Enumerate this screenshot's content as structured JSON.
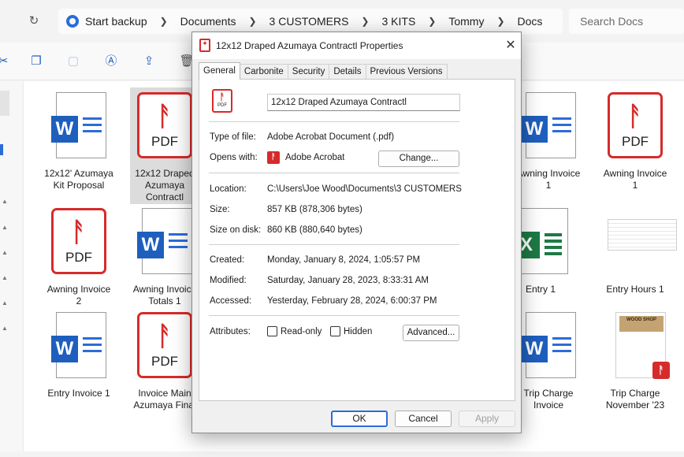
{
  "explorer": {
    "breadcrumb": [
      "Start backup",
      "Documents",
      "3 CUSTOMERS",
      "3 KITS",
      "Tommy",
      "Docs"
    ],
    "search_placeholder": "Search Docs"
  },
  "files": [
    {
      "name": "12x12' Azumaya Kit Proposal",
      "type": "word-icon"
    },
    {
      "name": "12x12 Draped Azumaya Contractl",
      "type": "pdf-icon"
    },
    {
      "name": "Awning Invoice 1",
      "type": "word-icon"
    },
    {
      "name": "Awning Invoice 1",
      "type": "pdf-icon"
    },
    {
      "name": "Awning Invoice 2",
      "type": "pdf-icon"
    },
    {
      "name": "Awning Invoice Totals 1",
      "type": "word-icon"
    },
    {
      "name": "Entry 1",
      "type": "excel-icon"
    },
    {
      "name": "Entry Hours 1",
      "type": "spreadsheet-thumbnail"
    },
    {
      "name": "Entry Invoice 1",
      "type": "word-icon"
    },
    {
      "name": "Invoice Main Azumaya Final",
      "type": "pdf-icon"
    },
    {
      "name": "Trip Charge Invoice",
      "type": "word-icon"
    },
    {
      "name": "Trip Charge November '23",
      "type": "pdf-thumbnail"
    }
  ],
  "icons": {
    "pdf_label": "PDF",
    "word_letter": "W",
    "excel_letter": "X",
    "thumb_header": "WOOD SHOP"
  },
  "dialog": {
    "title": "12x12 Draped Azumaya Contractl Properties",
    "close": "✕",
    "tabs": [
      "General",
      "Carbonite",
      "Security",
      "Details",
      "Previous Versions"
    ],
    "active_tab": "General",
    "file_name": "12x12 Draped Azumaya Contractl",
    "type_label": "Type of file:",
    "type_value": "Adobe Acrobat Document (.pdf)",
    "opens_label": "Opens with:",
    "opens_value": "Adobe Acrobat",
    "change_button": "Change...",
    "location_label": "Location:",
    "location_value": "C:\\Users\\Joe Wood\\Documents\\3 CUSTOMERS\\3 KITS\\Tommy\\Docs",
    "size_label": "Size:",
    "size_value": "857 KB (878,306 bytes)",
    "size_disk_label": "Size on disk:",
    "size_disk_value": "860 KB (880,640 bytes)",
    "created_label": "Created:",
    "created_value": "Monday, January 8, 2024, 1:05:57 PM",
    "modified_label": "Modified:",
    "modified_value": "Saturday, January 28, 2023, 8:33:31 AM",
    "accessed_label": "Accessed:",
    "accessed_value": "Yesterday, February 28, 2024, 6:00:37 PM",
    "attributes_label": "Attributes:",
    "readonly_label": "Read-only",
    "hidden_label": "Hidden",
    "advanced_button": "Advanced...",
    "ok_button": "OK",
    "cancel_button": "Cancel",
    "apply_button": "Apply"
  }
}
